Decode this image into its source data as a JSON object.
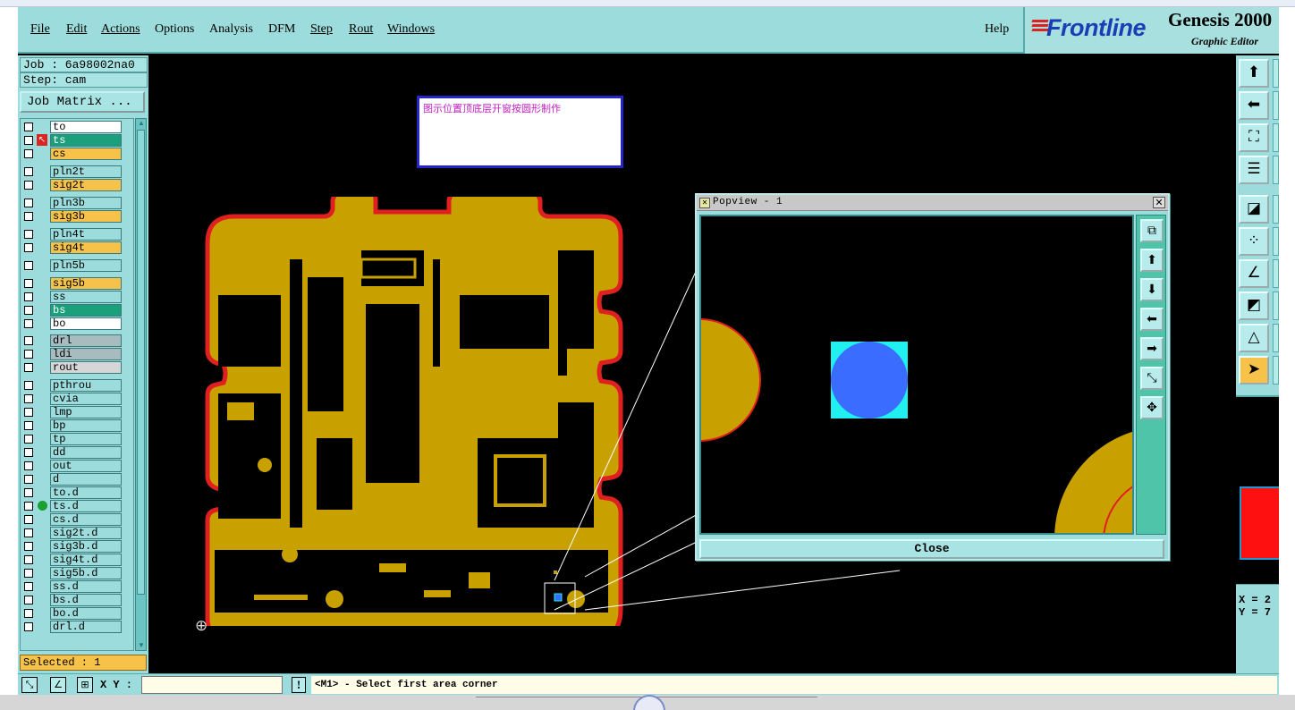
{
  "menu": {
    "items": [
      "File",
      "Edit",
      "Actions",
      "Options",
      "Analysis",
      "DFM",
      "Step",
      "Rout",
      "Windows"
    ],
    "help": "Help"
  },
  "brand": {
    "logo": "Frontline",
    "product": "Genesis 2000",
    "subtitle": "Graphic Editor"
  },
  "job": {
    "job_line": "Job : 6a98002na0",
    "step_line": "Step: cam",
    "matrix_button": "Job Matrix ..."
  },
  "layers": [
    {
      "name": "to",
      "color": "wht",
      "flag": "⬋"
    },
    {
      "name": "ts",
      "color": "grn",
      "flag": "▦",
      "active": true
    },
    {
      "name": "cs",
      "color": "org",
      "flag": "⬋"
    },
    {
      "name": "pln2t",
      "color": "cyan",
      "flag": ""
    },
    {
      "name": "sig2t",
      "color": "org",
      "flag": ""
    },
    {
      "name": "pln3b",
      "color": "cyan",
      "flag": ""
    },
    {
      "name": "sig3b",
      "color": "org",
      "flag": ""
    },
    {
      "name": "pln4t",
      "color": "cyan",
      "flag": ""
    },
    {
      "name": "sig4t",
      "color": "org",
      "flag": ""
    },
    {
      "name": "pln5b",
      "color": "cyan",
      "flag": ""
    },
    {
      "name": "sig5b",
      "color": "org",
      "flag": ""
    },
    {
      "name": "ss",
      "color": "cyan",
      "flag": "⬋"
    },
    {
      "name": "bs",
      "color": "grn",
      "flag": ""
    },
    {
      "name": "bo",
      "color": "wht",
      "flag": "⬋"
    },
    {
      "name": "drl",
      "color": "gry",
      "flag": ""
    },
    {
      "name": "ldi",
      "color": "gry",
      "flag": ""
    },
    {
      "name": "rout",
      "color": "lgr",
      "flag": ""
    },
    {
      "name": "pthrou",
      "color": "cyan",
      "flag": ""
    },
    {
      "name": "cvia",
      "color": "cyan",
      "flag": ""
    },
    {
      "name": "lmp",
      "color": "cyan",
      "flag": ""
    },
    {
      "name": "bp",
      "color": "cyan",
      "flag": ""
    },
    {
      "name": "tp",
      "color": "cyan",
      "flag": ""
    },
    {
      "name": "dd",
      "color": "cyan",
      "flag": ""
    },
    {
      "name": "out",
      "color": "cyan",
      "flag": ""
    },
    {
      "name": "d",
      "color": "cyan",
      "flag": ""
    },
    {
      "name": "to.d",
      "color": "cyan",
      "flag": "⬋"
    },
    {
      "name": "ts.d",
      "color": "cyan",
      "flag": "",
      "dot": true
    },
    {
      "name": "cs.d",
      "color": "cyan",
      "flag": "⬋"
    },
    {
      "name": "sig2t.d",
      "color": "cyan",
      "flag": ""
    },
    {
      "name": "sig3b.d",
      "color": "cyan",
      "flag": ""
    },
    {
      "name": "sig4t.d",
      "color": "cyan",
      "flag": ""
    },
    {
      "name": "sig5b.d",
      "color": "cyan",
      "flag": ""
    },
    {
      "name": "ss.d",
      "color": "cyan",
      "flag": "⬋"
    },
    {
      "name": "bs.d",
      "color": "cyan",
      "flag": ""
    },
    {
      "name": "bo.d",
      "color": "cyan",
      "flag": "⬋"
    },
    {
      "name": "drl.d",
      "color": "cyan",
      "flag": ""
    }
  ],
  "selected": "Selected : 1",
  "note": "图示位置顶底层开窗按圆形制作",
  "popview": {
    "title": "Popview - 1",
    "close_label": "Close"
  },
  "coords": {
    "x": "X = 2",
    "y": "Y = 7"
  },
  "status": {
    "xy_label": "X Y :",
    "xy_value": "",
    "message": "<M1> - Select first area corner"
  },
  "colors": {
    "panel": "#9cdcdc",
    "copper": "#c8a000",
    "board_edge": "#e02020",
    "pad_blue": "#3a6cff",
    "pad_cyan": "#20f0f0",
    "note_border": "#2424c8",
    "note_text": "#c020c0"
  }
}
